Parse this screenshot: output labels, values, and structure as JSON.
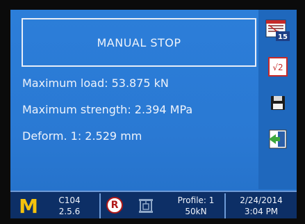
{
  "status": {
    "title": "MANUAL STOP"
  },
  "readings": [
    {
      "text": "Maximum load: 53.875 kN"
    },
    {
      "text": "Maximum strength: 2.394 MPa"
    },
    {
      "text": "Deform. 1: 2.529 mm"
    }
  ],
  "sidebar": {
    "calendar_badge": "15",
    "sqrt_label": "√2"
  },
  "statusbar": {
    "logo_letter": "M",
    "machine": {
      "line1": "C104",
      "line2": "2.5.6"
    },
    "remote_badge": "R",
    "profile": {
      "line1": "Profile: 1",
      "line2": "50kN"
    },
    "datetime": {
      "date": "2/24/2014",
      "time": "3:04 PM"
    }
  },
  "colors": {
    "screen_bg": "#2a79d3",
    "sidebar_bg": "#1f68bd",
    "statusbar_bg": "#0d2f66",
    "logo_yellow": "#f4c20d"
  }
}
